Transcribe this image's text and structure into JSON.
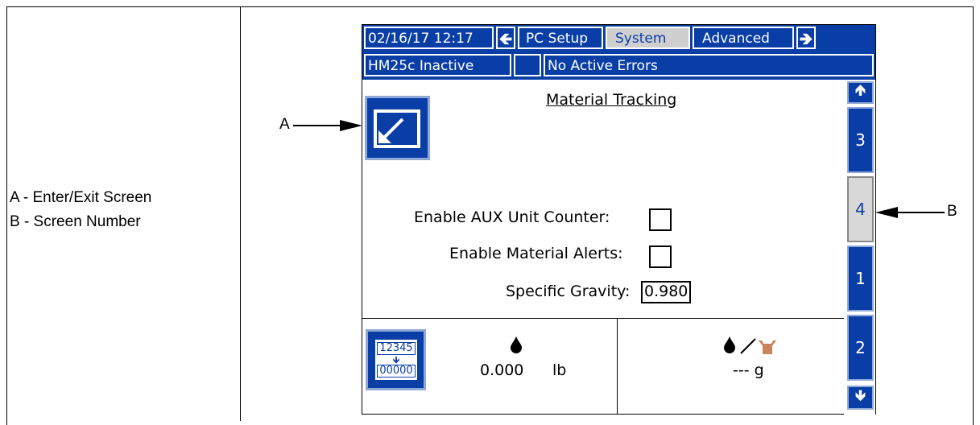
{
  "legend": {
    "a": "A - Enter/Exit Screen",
    "b": "B - Screen Number"
  },
  "callouts": {
    "a": "A",
    "b": "B"
  },
  "screen": {
    "tabs": {
      "datetime": "02/16/17 12:17",
      "pc_setup": "PC Setup",
      "system": "System",
      "advanced": "Advanced"
    },
    "status": {
      "unit": "HM25c Inactive",
      "errors": "No Active Errors"
    },
    "page_title": "Material Tracking",
    "fields": {
      "aux_label": "Enable AUX Unit Counter:",
      "alerts_label": "Enable Material Alerts:",
      "sg_label": "Specific Gravity:",
      "sg_value": "0.980"
    },
    "screens": [
      "3",
      "4",
      "1",
      "2"
    ],
    "active_screen": "4",
    "bottom": {
      "reset_top": "12345",
      "reset_bottom": "00000",
      "amount": "0.000",
      "amount_unit": "lb",
      "rate": "--- g"
    }
  },
  "colors": {
    "accent": "#0a3ea7",
    "active_tab": "#cfcfcf"
  },
  "icons": [
    "arrow-left-icon",
    "arrow-right-icon",
    "enter-exit-icon",
    "arrow-up-icon",
    "arrow-down-icon",
    "drop-icon",
    "cup-icon",
    "counter-reset-icon"
  ]
}
